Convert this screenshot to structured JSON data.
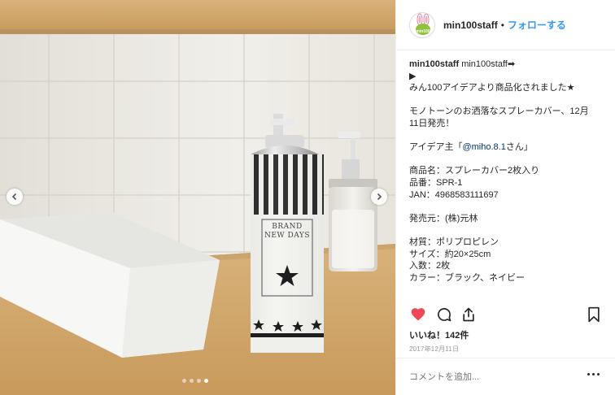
{
  "photo": {
    "label_line1": "BRAND",
    "label_line2": "NEW DAYS",
    "slide_count": 4,
    "active_slide": 4
  },
  "header": {
    "avatar_text": "min100",
    "username": "min100staff",
    "separator": "•",
    "follow_label": "フォローする"
  },
  "caption": {
    "user": "min100staff",
    "first_line_rest": " min100staff➡",
    "lines": [
      "▶",
      "みん100アイデアより商品化されました★",
      "",
      "モノトーンのお洒落なスプレーカバー、12月",
      "11日発売！",
      "",
      "アイデア主「",
      "",
      "商品名：スプレーカバー2枚入り",
      "品番：SPR-1",
      "JAN：4968583111697",
      "",
      "発売元：(株)元林",
      "",
      "材質：ポリプロピレン",
      "サイズ：約20×25cm",
      "入数：2枚",
      "カラー：ブラック、ネイビー"
    ],
    "idea_prefix": "アイデア主「",
    "idea_mention": "@miho.8.1",
    "idea_suffix": "さん」"
  },
  "actions": {
    "like_icon": "heart-icon",
    "comment_icon": "comment-icon",
    "share_icon": "share-icon",
    "save_icon": "bookmark-icon",
    "like_color": "#ed4956"
  },
  "likes_text": "いいね！142件",
  "date_text": "2017年12月11日",
  "comment_placeholder": "コメントを追加..."
}
